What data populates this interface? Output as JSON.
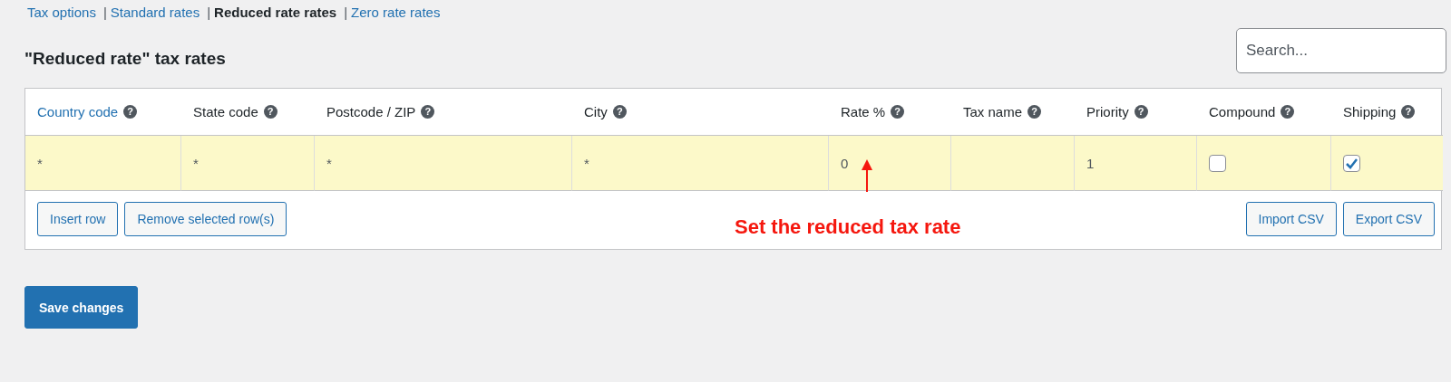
{
  "subnav": [
    {
      "label": "Tax options",
      "selected": false
    },
    {
      "separator": "|",
      "label": "Standard rates",
      "selected": false
    },
    {
      "separator": "|",
      "label": "Reduced rate rates",
      "selected": true
    },
    {
      "separator": "|",
      "label": "Zero rate rates",
      "selected": false
    }
  ],
  "heading": "\"Reduced rate\" tax rates",
  "search": {
    "placeholder": "Search..."
  },
  "table": {
    "columns": [
      {
        "label": "Country code",
        "link": true,
        "help": "?"
      },
      {
        "label": "State code",
        "link": false,
        "help": "?"
      },
      {
        "label": "Postcode / ZIP",
        "link": false,
        "help": "?"
      },
      {
        "label": "City",
        "link": false,
        "help": "?"
      },
      {
        "label": "Rate %",
        "link": false,
        "help": "?"
      },
      {
        "label": "Tax name",
        "link": false,
        "help": "?"
      },
      {
        "label": "Priority",
        "link": false,
        "help": "?"
      },
      {
        "label": "Compound",
        "link": false,
        "help": "?"
      },
      {
        "label": "Shipping",
        "link": false,
        "help": "?"
      }
    ],
    "rows": [
      {
        "selected": true,
        "cells": [
          {
            "kind": "text",
            "value": "*"
          },
          {
            "kind": "text",
            "value": "*"
          },
          {
            "kind": "text",
            "value": "*"
          },
          {
            "kind": "text",
            "value": "*"
          },
          {
            "kind": "text",
            "value": "0"
          },
          {
            "kind": "text"
          },
          {
            "kind": "text",
            "value": "1"
          },
          {
            "kind": "checkbox",
            "checked": false
          },
          {
            "kind": "checkbox",
            "checked": true
          }
        ]
      }
    ],
    "left_buttons": [
      "Insert row",
      "Remove selected row(s)"
    ],
    "right_buttons": [
      "Import CSV",
      "Export CSV"
    ]
  },
  "annotation": "Set the reduced tax rate",
  "save_button": "Save changes"
}
